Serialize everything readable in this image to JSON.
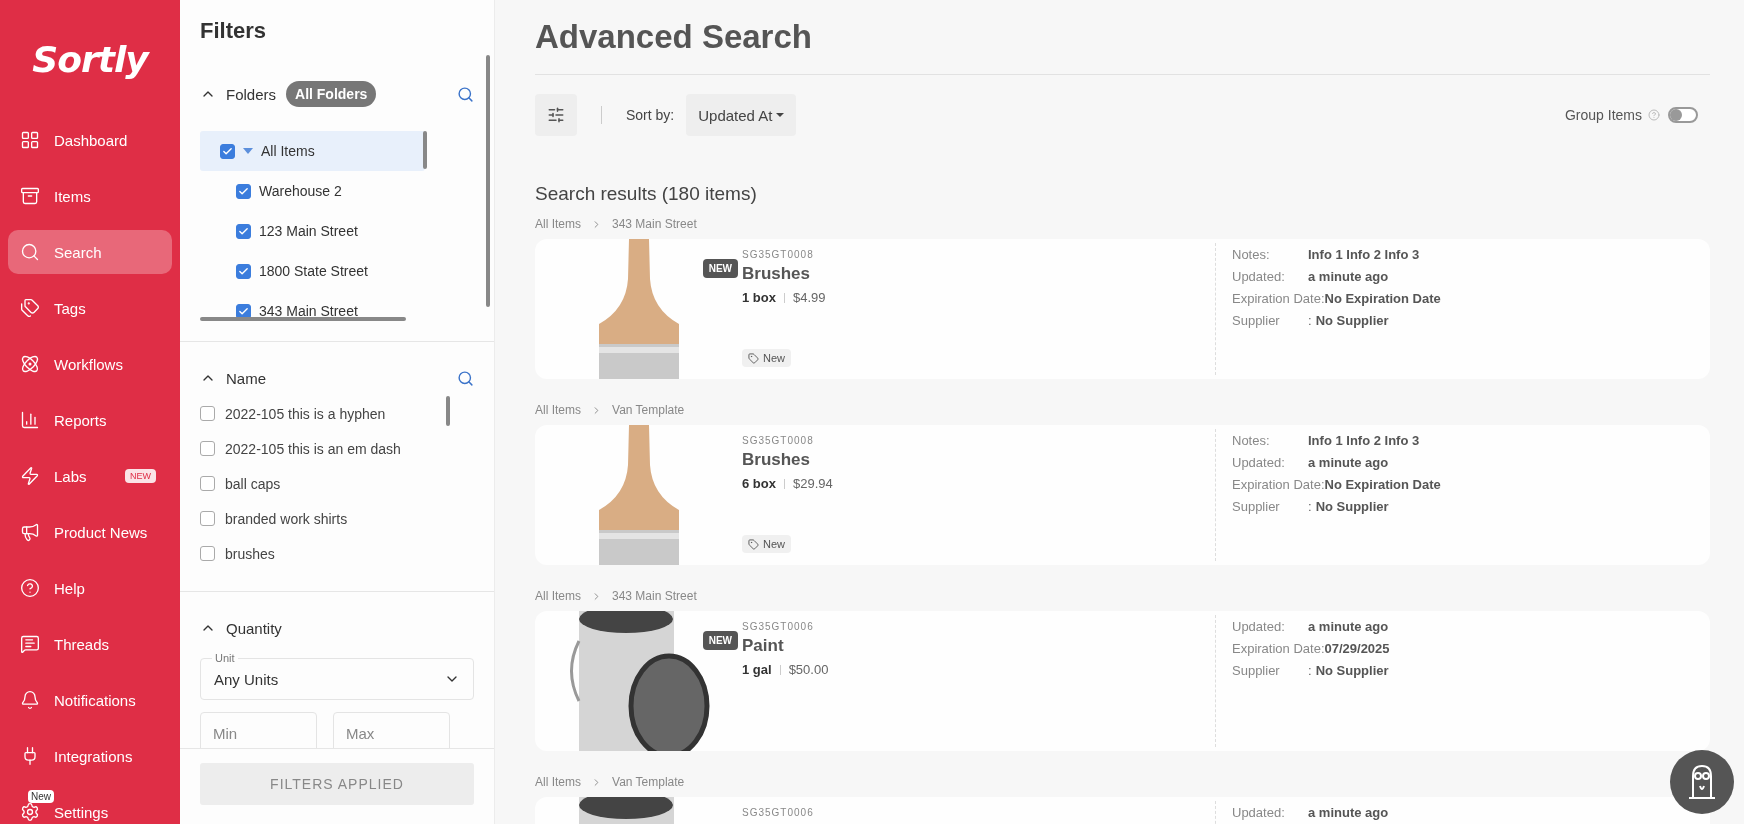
{
  "sidebar": {
    "logo": "Sortly",
    "items": [
      {
        "label": "Dashboard",
        "selected": false
      },
      {
        "label": "Items",
        "selected": false
      },
      {
        "label": "Search",
        "selected": true
      },
      {
        "label": "Tags",
        "selected": false
      },
      {
        "label": "Workflows",
        "selected": false
      },
      {
        "label": "Reports",
        "selected": false
      },
      {
        "label": "Labs",
        "selected": false,
        "badge": "NEW"
      },
      {
        "label": "Product News",
        "selected": false
      },
      {
        "label": "Help",
        "selected": false
      },
      {
        "label": "Threads",
        "selected": false
      },
      {
        "label": "Notifications",
        "selected": false
      },
      {
        "label": "Integrations",
        "selected": false
      },
      {
        "label": "Settings",
        "selected": false,
        "icon_badge": "New"
      }
    ]
  },
  "filters": {
    "title": "Filters",
    "folders": {
      "title": "Folders",
      "expanded": true,
      "chip": "All Folders",
      "tree": [
        {
          "label": "All Items",
          "checked": true,
          "selected": true,
          "expanded": true,
          "children": [
            {
              "label": "Warehouse 2",
              "checked": true,
              "selected": false
            },
            {
              "label": "123 Main Street",
              "checked": true,
              "selected": false
            },
            {
              "label": "1800 State Street",
              "checked": true,
              "selected": false
            },
            {
              "label": "343 Main Street",
              "checked": true,
              "selected": false
            }
          ]
        }
      ]
    },
    "name": {
      "title": "Name",
      "expanded": true,
      "items": [
        {
          "label": "2022-105 this is a hyphen",
          "checked": false
        },
        {
          "label": "2022-105 this is an em dash",
          "checked": false
        },
        {
          "label": "ball caps",
          "checked": false
        },
        {
          "label": "branded work shirts",
          "checked": false
        },
        {
          "label": "brushes",
          "checked": false
        }
      ]
    },
    "quantity": {
      "title": "Quantity",
      "expanded": true,
      "unit_label": "Unit",
      "unit_value": "Any Units",
      "min_placeholder": "Min",
      "max_placeholder": "Max"
    },
    "apply_button": "FILTERS APPLIED"
  },
  "main": {
    "title": "Advanced Search",
    "sort_label": "Sort by:",
    "sort_value": "Updated At",
    "group_items": {
      "label": "Group Items",
      "on": false
    },
    "results_title": "Search results (180 items)",
    "results": [
      {
        "path": [
          "All Items",
          "343 Main Street"
        ],
        "kind": "brush",
        "new_badge": "NEW",
        "sku": "SG35GT0008",
        "name": "Brushes",
        "qty": "1 box",
        "price": "$4.99",
        "tag": "New",
        "details": [
          {
            "label": "Notes:",
            "value": "Info 1 Info 2 Info 3"
          },
          {
            "label": "Updated:",
            "value": "a minute ago"
          },
          {
            "label": "Expiration Date:",
            "value": "No Expiration Date"
          },
          {
            "label": "Supplier",
            "sep": ":",
            "value": "No Supplier"
          }
        ]
      },
      {
        "path": [
          "All Items",
          "Van Template"
        ],
        "kind": "brush",
        "sku": "SG35GT0008",
        "name": "Brushes",
        "qty": "6 box",
        "price": "$29.94",
        "tag": "New",
        "details": [
          {
            "label": "Notes:",
            "value": "Info 1 Info 2 Info 3"
          },
          {
            "label": "Updated:",
            "value": "a minute ago"
          },
          {
            "label": "Expiration Date:",
            "value": "No Expiration Date"
          },
          {
            "label": "Supplier",
            "sep": ":",
            "value": "No Supplier"
          }
        ]
      },
      {
        "path": [
          "All Items",
          "343 Main Street"
        ],
        "kind": "can",
        "new_badge": "NEW",
        "sku": "SG35GT0006",
        "name": "Paint",
        "qty": "1 gal",
        "price": "$50.00",
        "details": [
          {
            "label": "Updated:",
            "value": "a minute ago"
          },
          {
            "label": "Expiration Date:",
            "value": "07/29/2025"
          },
          {
            "label": "Supplier",
            "sep": ":",
            "value": "No Supplier"
          }
        ]
      },
      {
        "path": [
          "All Items",
          "Van Template"
        ],
        "kind": "can",
        "sku": "SG35GT0006",
        "details": [
          {
            "label": "Updated:",
            "value": "a minute ago"
          }
        ]
      }
    ]
  }
}
